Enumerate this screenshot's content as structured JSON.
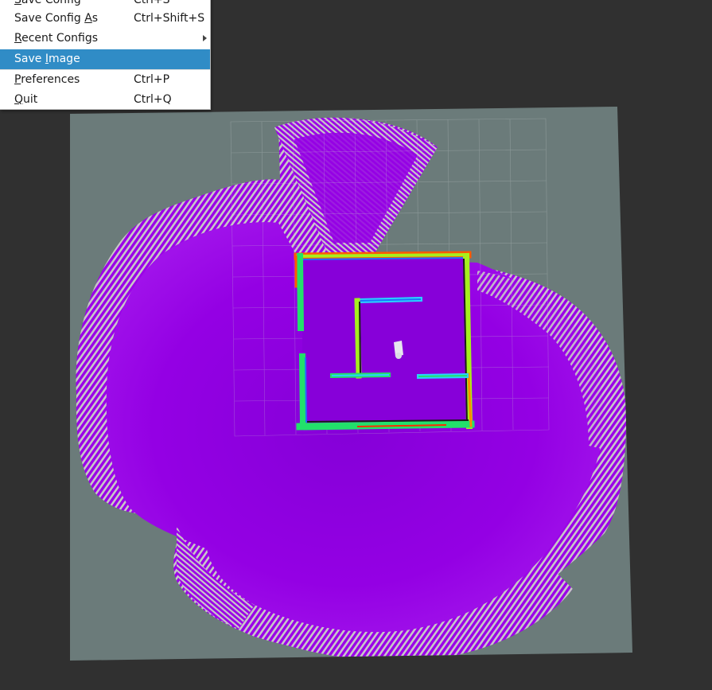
{
  "menu": {
    "items": [
      {
        "label": "Save Config",
        "mnemonic": "S",
        "shortcut": "Ctrl+S",
        "highlighted": false,
        "submenu": false
      },
      {
        "label": "Save Config As",
        "mnemonic": "A",
        "shortcut": "Ctrl+Shift+S",
        "highlighted": false,
        "submenu": false
      },
      {
        "label": "Recent Configs",
        "mnemonic": "R",
        "shortcut": "",
        "highlighted": false,
        "submenu": true
      },
      {
        "label": "Save Image",
        "mnemonic": "I",
        "shortcut": "",
        "highlighted": true,
        "submenu": false
      },
      {
        "label": "Preferences",
        "mnemonic": "P",
        "shortcut": "Ctrl+P",
        "highlighted": false,
        "submenu": false
      },
      {
        "label": "Quit",
        "mnemonic": "Q",
        "shortcut": "Ctrl+Q",
        "highlighted": false,
        "submenu": false
      }
    ]
  },
  "scene": {
    "background_color": "#303030",
    "map_floor_color": "#6b7b7a",
    "unknown_color": "#c8c8c8",
    "scan_color": "#9b00e8",
    "grid_color": "#a8b3b3",
    "robot_color": "#e6e6ee",
    "wall_colors": [
      "#1a1a1a",
      "#1f6fff",
      "#2ad1ff",
      "#22e06b",
      "#a6ef1e",
      "#ff8a00",
      "#ff2a00"
    ]
  }
}
